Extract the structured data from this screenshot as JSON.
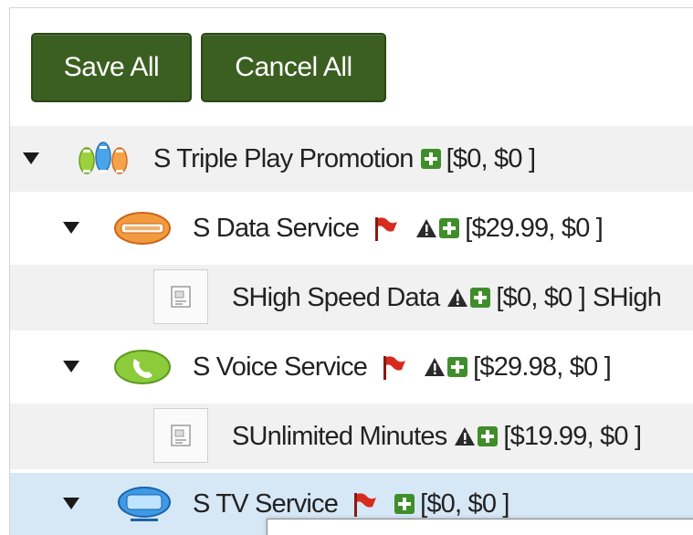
{
  "toolbar": {
    "save_label": "Save All",
    "cancel_label": "Cancel All"
  },
  "tree": {
    "promotion": {
      "label": "S Triple Play Promotion",
      "price": "[$0, $0 ]"
    },
    "data_service": {
      "label": "S Data Service",
      "price": "[$29.99, $0 ]"
    },
    "high_speed": {
      "label": "SHigh Speed Data",
      "price": "[$0, $0 ]",
      "trailing": "SHigh"
    },
    "voice_service": {
      "label": "S Voice Service",
      "price": "[$29.98, $0 ]"
    },
    "unlimited": {
      "label": "SUnlimited Minutes",
      "price": "[$19.99, $0 ]"
    },
    "tv_service": {
      "label": "S TV Service",
      "price": "[$0, $0 ]"
    }
  },
  "colors": {
    "button_bg": "#3b5f21",
    "selected_row": "#d6e7f6",
    "alt_row": "#f1f1f1",
    "flag": "#d62b1e",
    "plus": "#3f8e2b"
  },
  "icons": {
    "caret": "caret-down-icon",
    "flag": "flag-icon",
    "warning": "warning-icon",
    "add": "plus-icon",
    "product": "product-placeholder-icon"
  }
}
